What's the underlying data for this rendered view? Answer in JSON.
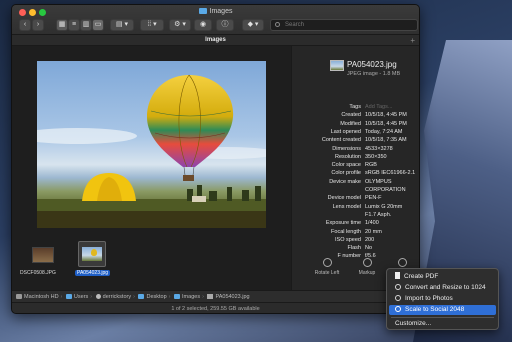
{
  "window": {
    "title": "Images"
  },
  "search": {
    "placeholder": "Search"
  },
  "tab": {
    "label": "Images",
    "add": "+"
  },
  "thumbnails": [
    {
      "label": "DSCF0508.JPG",
      "selected": false
    },
    {
      "label": "PA054023.jpg",
      "selected": true
    }
  ],
  "info": {
    "file_name": "PA054023.jpg",
    "file_kind": "JPEG image - 1.8 MB",
    "rows": [
      {
        "key": "Tags",
        "value": "Add Tags...",
        "placeholder": true
      },
      {
        "key": "Created",
        "value": "10/5/18, 4:45 PM"
      },
      {
        "key": "Modified",
        "value": "10/5/18, 4:45 PM"
      },
      {
        "key": "Last opened",
        "value": "Today, 7:24 AM"
      },
      {
        "key": "Content created",
        "value": "10/5/18, 7:35 AM"
      },
      {
        "key": "Dimensions",
        "value": "4533×3278"
      },
      {
        "key": "Resolution",
        "value": "350×350"
      },
      {
        "key": "Color space",
        "value": "RGB"
      },
      {
        "key": "Color profile",
        "value": "sRGB IEC61966-2.1"
      },
      {
        "key": "Device make",
        "value": "OLYMPUS"
      },
      {
        "key": "",
        "value": "CORPORATION"
      },
      {
        "key": "Device model",
        "value": "PEN-F"
      },
      {
        "key": "Lens model",
        "value": "Lumix G 20mm"
      },
      {
        "key": "",
        "value": "F1.7 Asph."
      },
      {
        "key": "Exposure time",
        "value": "1/400"
      },
      {
        "key": "Focal length",
        "value": "20 mm"
      },
      {
        "key": "ISO speed",
        "value": "200"
      },
      {
        "key": "Flash",
        "value": "No"
      },
      {
        "key": "F number",
        "value": "f/5.6"
      }
    ],
    "actions": [
      {
        "label": "Rotate Left",
        "icon": "rotate-left-icon"
      },
      {
        "label": "Markup",
        "icon": "markup-icon"
      },
      {
        "label": "",
        "icon": "more-icon"
      }
    ]
  },
  "path": [
    "Macintosh HD",
    "Users",
    "derrickstory",
    "Desktop",
    "Images",
    "PA054023.jpg"
  ],
  "status": "1 of 2 selected, 259.55 GB available",
  "context_menu": {
    "items": [
      {
        "label": "Create PDF",
        "icon": "document-icon"
      },
      {
        "label": "Convert and Resize to 1024",
        "icon": "gear-icon"
      },
      {
        "label": "Import to Photos",
        "icon": "gear-icon"
      },
      {
        "label": "Scale to Social 2048",
        "icon": "gear-icon",
        "selected": true
      }
    ],
    "customize": "Customize..."
  },
  "colors": {
    "accent": "#2f6fd6",
    "selection": "#1f5fc7"
  }
}
